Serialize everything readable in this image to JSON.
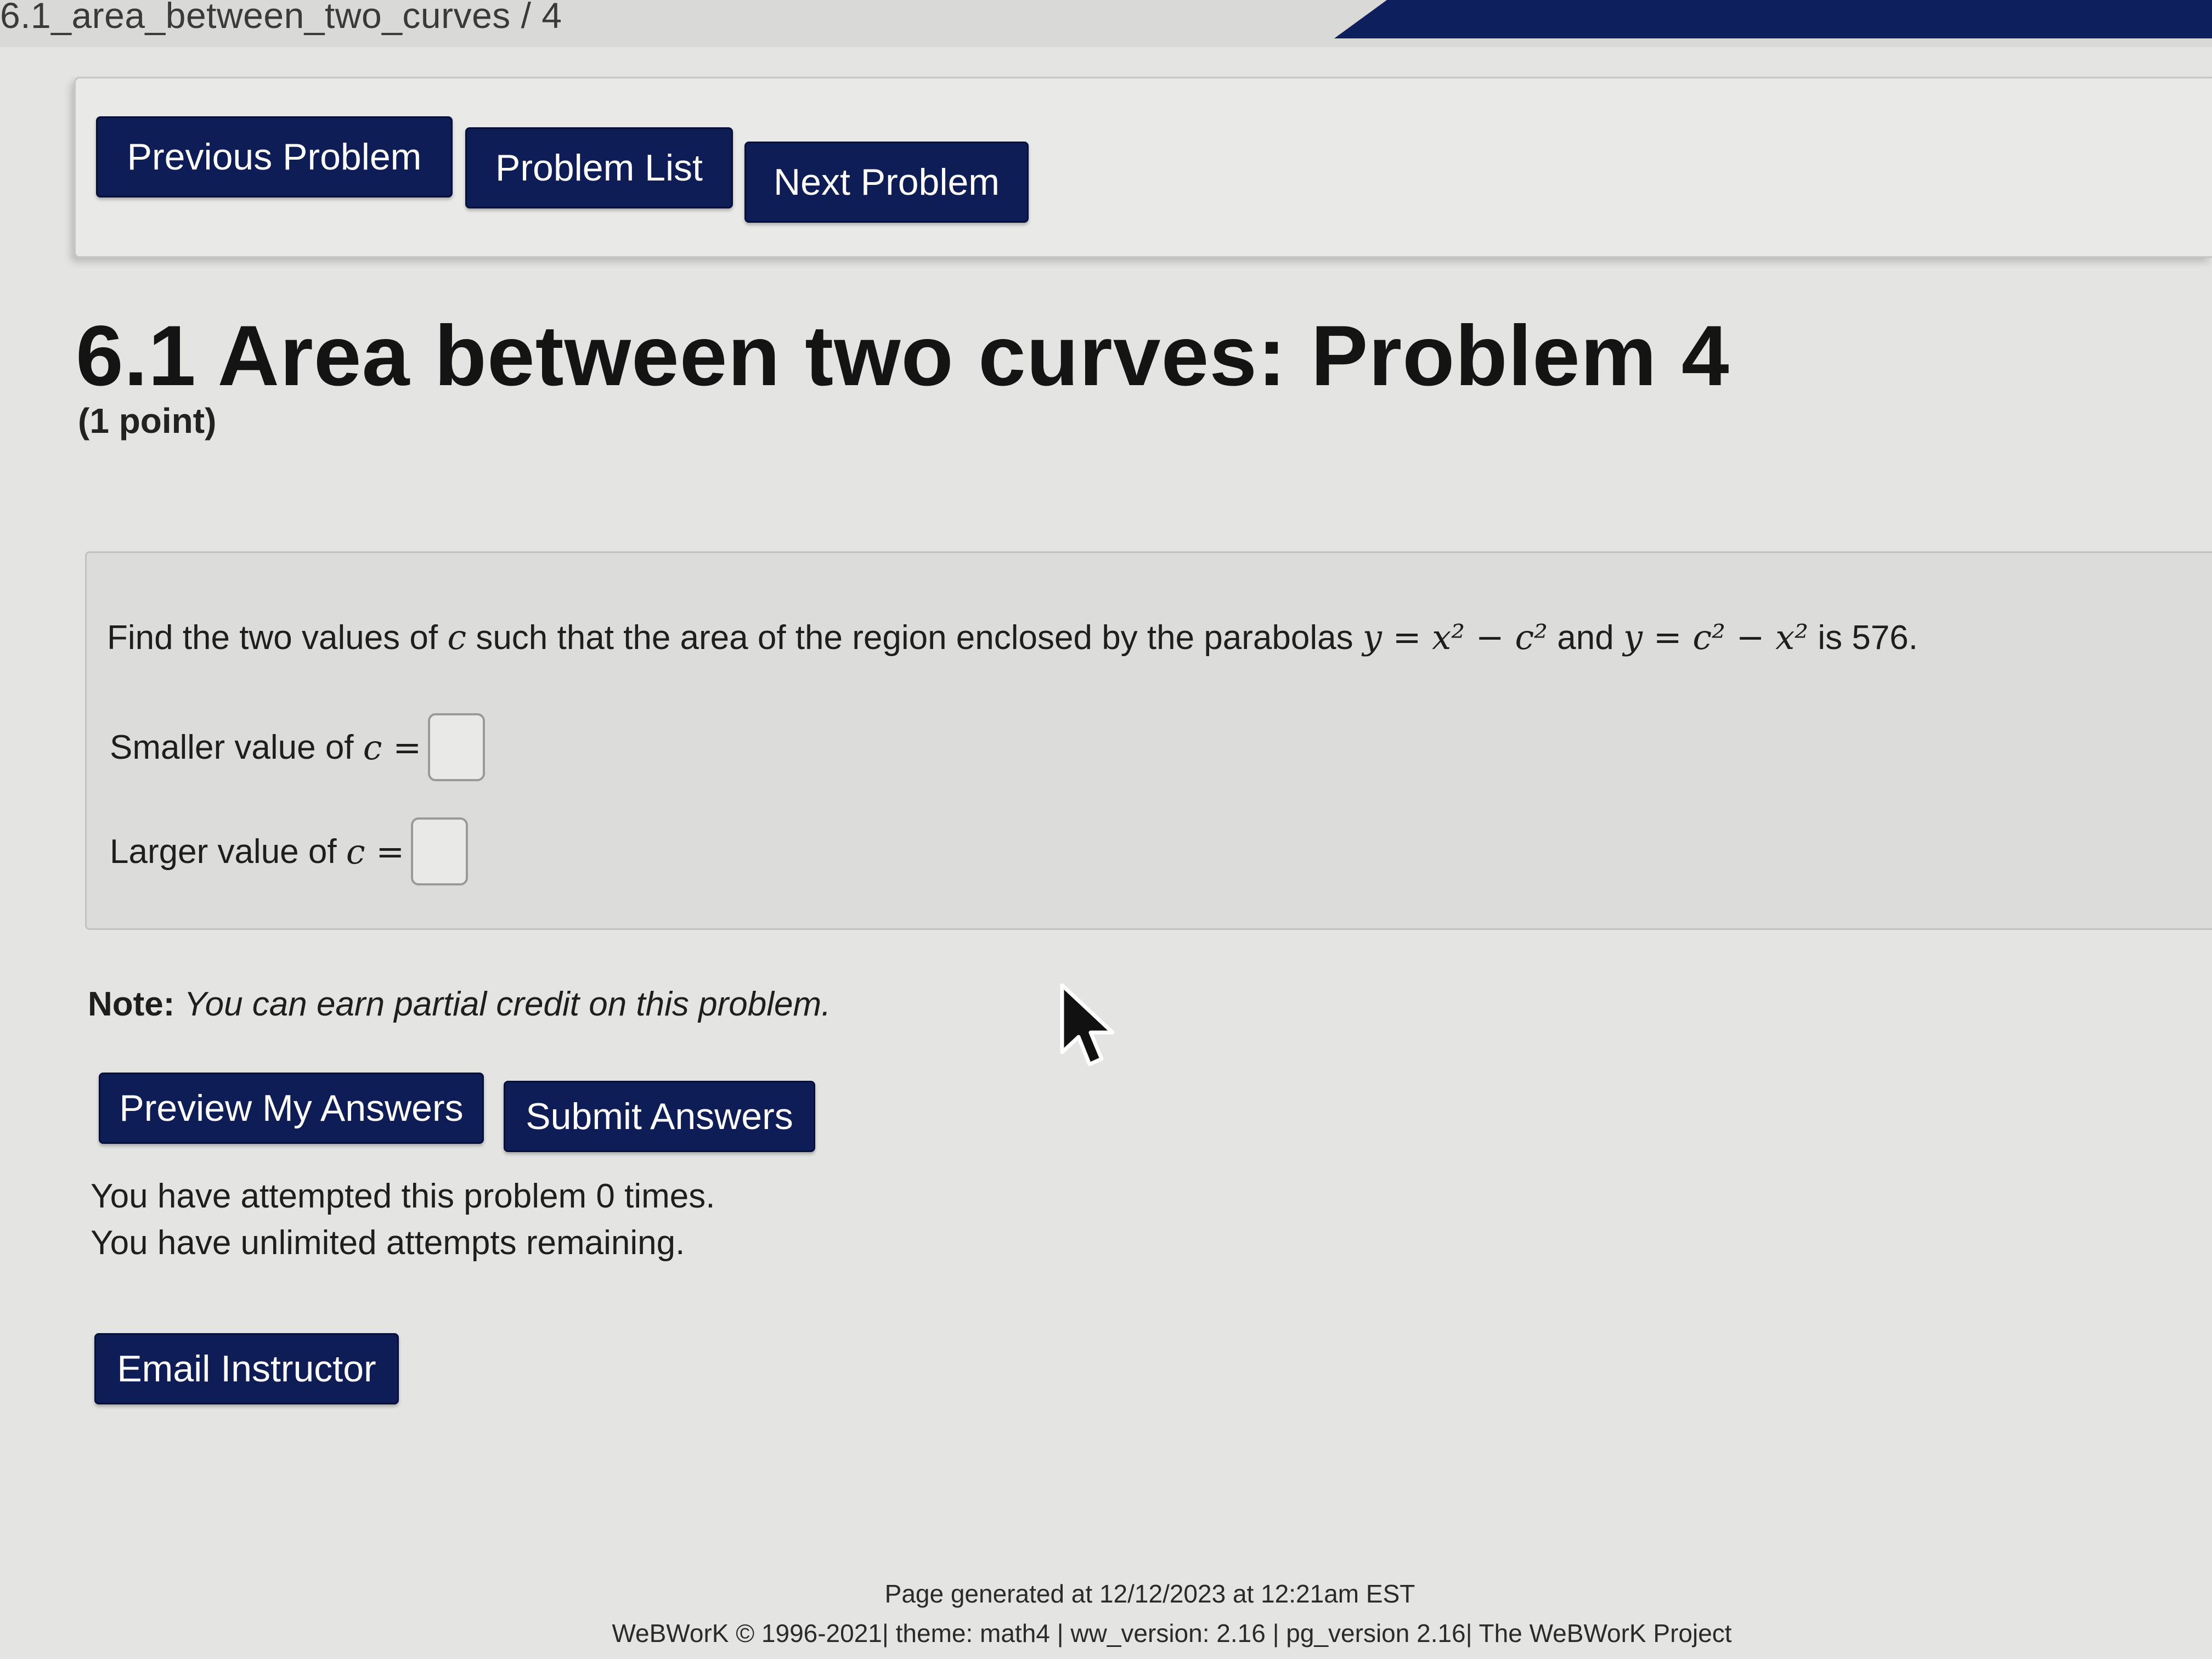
{
  "header": {
    "breadcrumb": "6.1_area_between_two_curves / 4"
  },
  "nav": {
    "previous": "Previous Problem",
    "list": "Problem List",
    "next": "Next Problem"
  },
  "problem": {
    "title": "6.1 Area between two curves: Problem 4",
    "points": "(1 point)",
    "statement_intro": "Find the two values of",
    "statement_var": "c",
    "statement_mid": "such that the area of the region enclosed by the parabolas",
    "eq1": "y = x² − c²",
    "connector": "and",
    "eq2": "y = c² − x²",
    "statement_end": "is 576.",
    "smaller_label": "Smaller value of",
    "larger_label": "Larger value of",
    "answer_var": "c =",
    "smaller_value": "",
    "larger_value": ""
  },
  "note": {
    "label": "Note:",
    "text": "You can earn partial credit on this problem."
  },
  "actions": {
    "preview": "Preview My Answers",
    "submit": "Submit Answers",
    "email": "Email Instructor"
  },
  "status": {
    "attempted": "You have attempted this problem 0 times.",
    "remaining": "You have unlimited attempts remaining."
  },
  "footer": {
    "generated": "Page generated at 12/12/2023 at 12:21am EST",
    "credits": "WeBWorK © 1996-2021| theme: math4 | ww_version: 2.16 | pg_version 2.16| The WeBWorK Project"
  },
  "colors": {
    "button_bg": "#0f1d57",
    "page_bg": "#e4e5e3",
    "accent_bar": "#0e1f5e"
  }
}
